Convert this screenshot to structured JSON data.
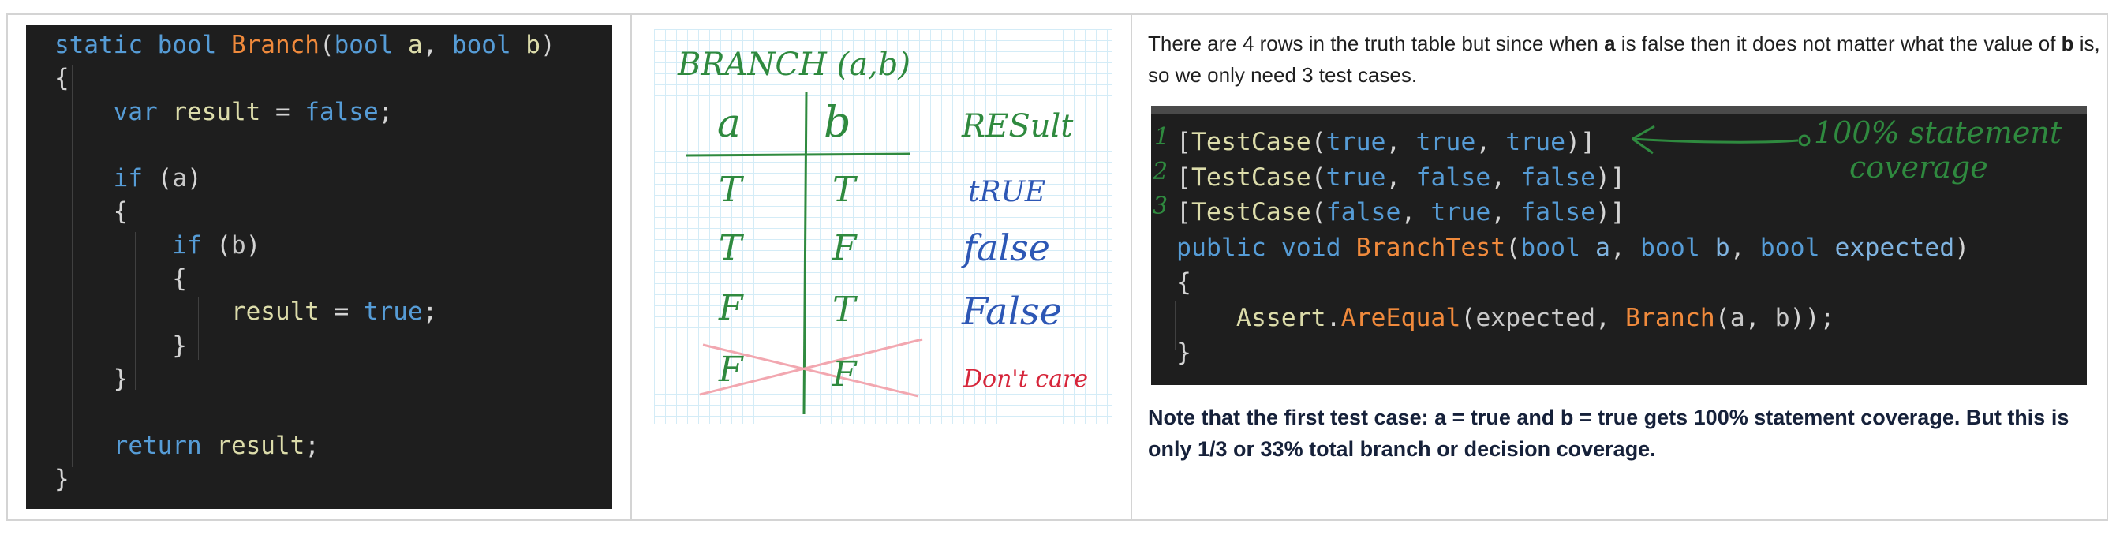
{
  "code1": {
    "lines": [
      [
        "static",
        " ",
        "bool",
        " ",
        "Branch",
        "(",
        "bool",
        " ",
        "a",
        ", ",
        "bool",
        " ",
        "b",
        ")"
      ],
      [
        "{"
      ],
      [
        "    ",
        "var",
        " ",
        "result",
        " = ",
        "false",
        ";"
      ],
      [
        ""
      ],
      [
        "    ",
        "if",
        " (",
        "a",
        ")"
      ],
      [
        "    {"
      ],
      [
        "        ",
        "if",
        " (",
        "b",
        ")"
      ],
      [
        "        {"
      ],
      [
        "            ",
        "result",
        " = ",
        "true",
        ";"
      ],
      [
        "        }"
      ],
      [
        "    }"
      ],
      [
        ""
      ],
      [
        "    ",
        "return",
        " ",
        "result",
        ";"
      ],
      [
        "}"
      ]
    ]
  },
  "handwritten": {
    "title": "BRANCH (a,b)",
    "col_a": "a",
    "col_b": "b",
    "col_result": "RESult",
    "rows": [
      {
        "a": "T",
        "b": "T",
        "result": "tRUE"
      },
      {
        "a": "T",
        "b": "F",
        "result": "false"
      },
      {
        "a": "F",
        "b": "T",
        "result": "False"
      },
      {
        "a": "F",
        "b": "F",
        "result": "Don't care"
      }
    ]
  },
  "intro": {
    "part1": "There are 4 rows in the truth table but since when ",
    "a": "a",
    "part2": " is false then it does not matter what the value of  ",
    "b": "b",
    "part3": " is, so we only need 3 test cases."
  },
  "code2": {
    "line_numbers": [
      "1",
      "2",
      "3"
    ],
    "lines": [
      "[TestCase(true, true, true)]",
      "[TestCase(true, false, false)]",
      "[TestCase(false, true, false)]",
      "public void BranchTest(bool a, bool b, bool expected)",
      "{",
      "    Assert.AreEqual(expected, Branch(a, b));",
      "}"
    ],
    "annotation_line1": "100% statement",
    "annotation_line2": "coverage"
  },
  "note": "Note that the first test case: a = true and b = true gets 100% statement coverage. But this is only 1/3 or 33% total branch or decision coverage.",
  "colors": {
    "code_bg": "#1e1e1e",
    "keyword": "#569cd6",
    "function": "#f08a3c",
    "variable": "#dcdcaa",
    "annotation_green": "#2f8a3f",
    "handwriting_blue": "#2d57b5",
    "handwriting_red": "#d6263b"
  }
}
